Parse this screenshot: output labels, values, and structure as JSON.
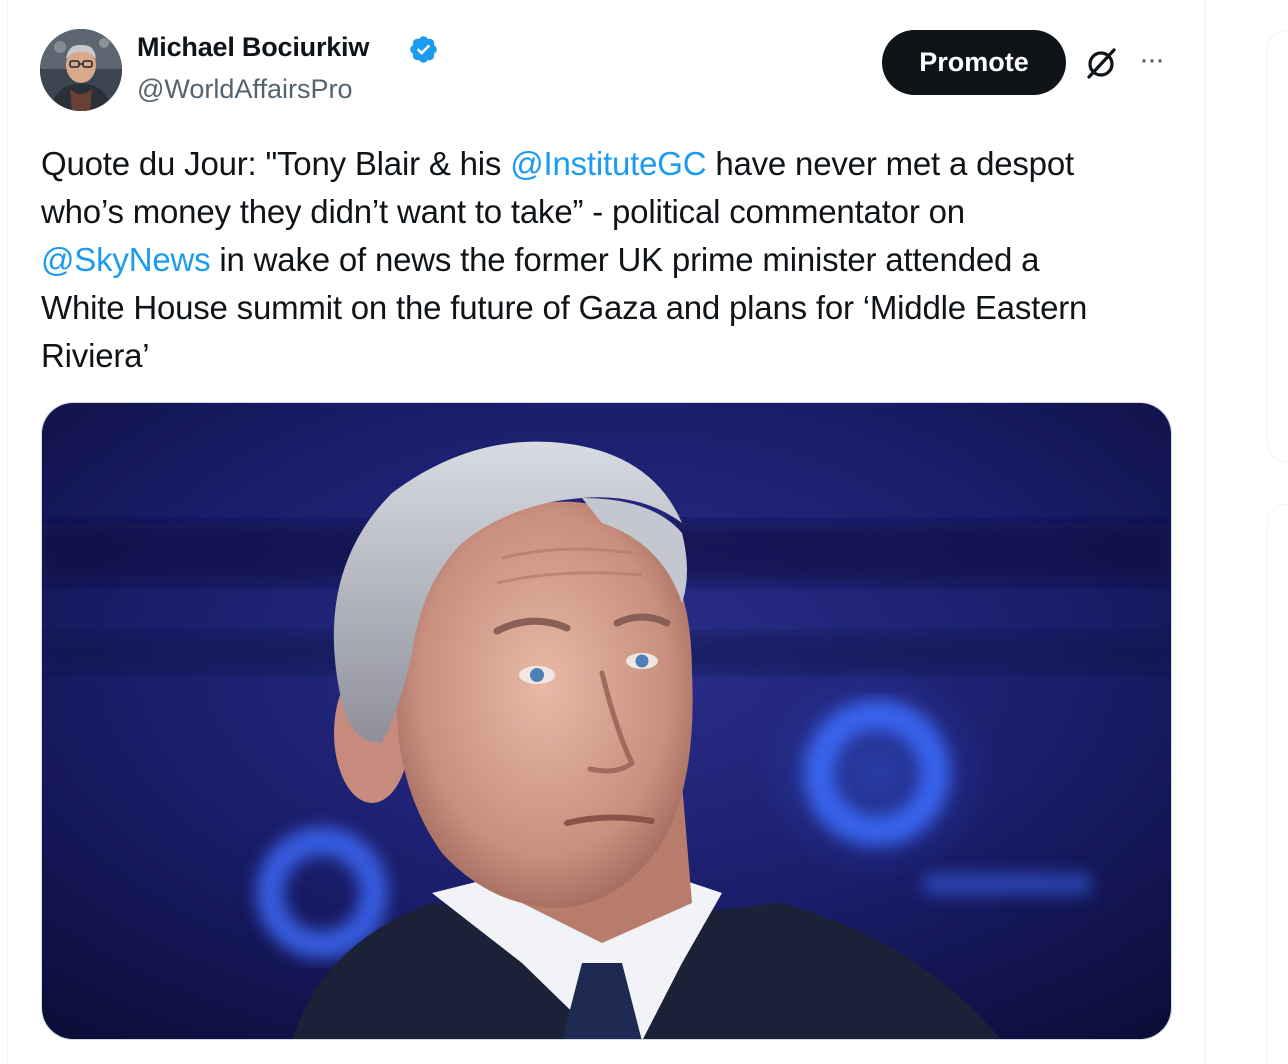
{
  "author": {
    "name": "Michael Bociurkiw",
    "handle": "@WorldAffairsPro",
    "verified": true,
    "avatar_icon": "profile-photo"
  },
  "actions": {
    "promote_label": "Promote",
    "grok_icon": "slashed-circle-icon",
    "more_icon": "more-icon",
    "more_label": "···"
  },
  "tweet": {
    "lines": [
      [
        {
          "text": "Quote du Jour: \"Tony Blair & his ",
          "mention": false
        },
        {
          "text": "@InstituteGC",
          "mention": true
        },
        {
          "text": " have never met a despot",
          "mention": false
        }
      ],
      [
        {
          "text": "who’s money they didn’t want to take” - political commentator on",
          "mention": false
        }
      ],
      [
        {
          "text": "@SkyNews",
          "mention": true
        },
        {
          "text": " in wake of news the former UK prime minister attended a",
          "mention": false
        }
      ],
      [
        {
          "text": "White House summit on the future of Gaza and plans for ‘Middle Eastern",
          "mention": false
        }
      ],
      [
        {
          "text": "Riviera’",
          "mention": false
        }
      ]
    ]
  },
  "media": {
    "type": "photo",
    "subject": "portrait-photo"
  },
  "colors": {
    "mention": "#1d9bf0",
    "text": "#0f1419",
    "secondary": "#536471",
    "verified": "#1d9bf0",
    "button_bg": "#0f1419"
  }
}
